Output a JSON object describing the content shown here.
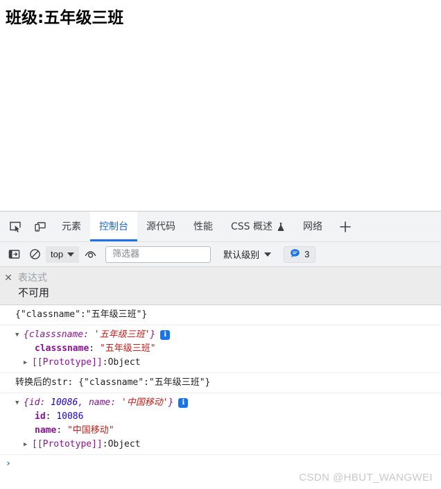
{
  "page": {
    "heading": "班级:五年级三班"
  },
  "devtools": {
    "main_tabs": {
      "inspect_icon": "inspect-element-icon",
      "device_icon": "device-toolbar-icon",
      "items": [
        {
          "label": "元素",
          "active": false
        },
        {
          "label": "控制台",
          "active": true
        },
        {
          "label": "源代码",
          "active": false
        },
        {
          "label": "性能",
          "active": false
        },
        {
          "label": "CSS 概述",
          "active": false,
          "experimental": true
        },
        {
          "label": "网络",
          "active": false
        }
      ],
      "add_label": "+"
    },
    "console_toolbar": {
      "sidebar_icon": "show-console-sidebar-icon",
      "clear_icon": "clear-console-icon",
      "context": "top",
      "eye_icon": "create-live-expression-icon",
      "filter_placeholder": "筛选器",
      "filter_value": "",
      "levels": "默认级别",
      "message_count": "3",
      "message_icon": "message-bubble-icon"
    },
    "live_expression": {
      "close_icon": "close-icon",
      "name": "表达式",
      "value": "不可用"
    },
    "messages": [
      {
        "kind": "text",
        "text": "{\"classname\":\"五年级三班\"}"
      },
      {
        "kind": "object",
        "expanded": true,
        "preview_open": "{",
        "preview_key": "classsname",
        "preview_colon": ": ",
        "preview_value": "'五年级三班'",
        "preview_close": "}",
        "info_badge": "i",
        "properties": [
          {
            "key": "classsname",
            "sep": ": ",
            "value": "\"五年级三班\"",
            "type": "string"
          }
        ],
        "proto_tri": "closed",
        "proto_key": "[[Prototype]]",
        "proto_sep": ": ",
        "proto_value": "Object"
      },
      {
        "kind": "text",
        "text": "转换后的str: {\"classname\":\"五年级三班\"}"
      },
      {
        "kind": "object",
        "expanded": true,
        "preview_open": "{",
        "preview_key": "id",
        "preview_colon": ": ",
        "preview_value": "10086",
        "preview_key2": "name",
        "preview_colon2": ": ",
        "preview_value2": "'中国移动'",
        "preview_close": "}",
        "info_badge": "i",
        "properties": [
          {
            "key": "id",
            "sep": ": ",
            "value": "10086",
            "type": "number"
          },
          {
            "key": "name",
            "sep": ": ",
            "value": "\"中国移动\"",
            "type": "string"
          }
        ],
        "proto_tri": "closed",
        "proto_key": "[[Prototype]]",
        "proto_sep": ": ",
        "proto_value": "Object"
      }
    ],
    "prompt": {
      "chevron": "›",
      "value": ""
    }
  },
  "watermark": "CSDN @HBUT_WANGWEI",
  "colors": {
    "accent": "#1a73e8",
    "toolbar_bg": "#f1f3f4",
    "key_purple": "#881391",
    "string_red": "#c41a16",
    "number_blue": "#1c00cf",
    "muted": "#9aa0a6"
  }
}
